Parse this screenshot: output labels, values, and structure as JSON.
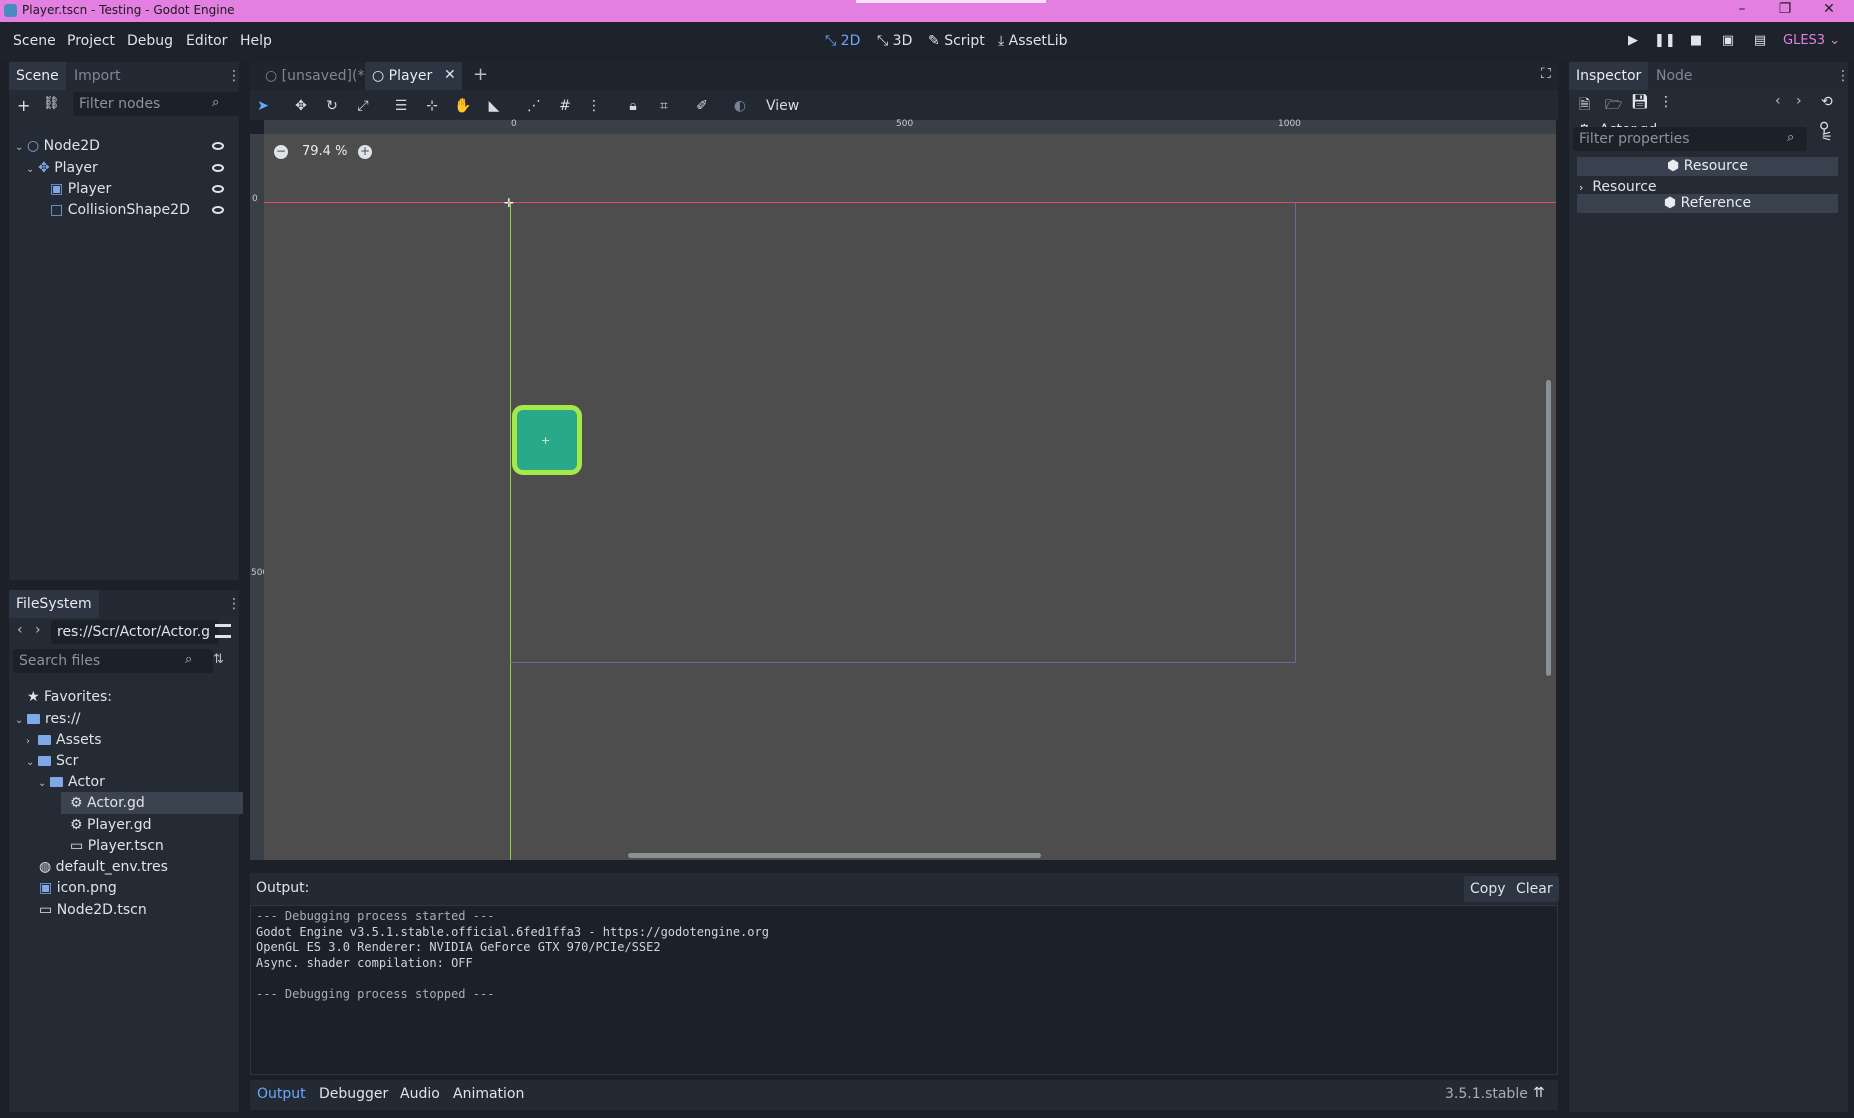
{
  "window": {
    "title": "Player.tscn - Testing - Godot Engine",
    "minimize": "–",
    "maximize": "❐",
    "close": "✕"
  },
  "menu": [
    "Scene",
    "Project",
    "Debug",
    "Editor",
    "Help"
  ],
  "workspaces": [
    {
      "label": "2D",
      "icon": "2d-icon",
      "active": true
    },
    {
      "label": "3D",
      "icon": "3d-icon",
      "active": false
    },
    {
      "label": "Script",
      "icon": "script-icon",
      "active": false
    },
    {
      "label": "AssetLib",
      "icon": "assetlib-icon",
      "active": false
    }
  ],
  "renderer": "GLES3",
  "scene_dock": {
    "tabs": [
      "Scene",
      "Import"
    ],
    "filter_placeholder": "Filter nodes",
    "tree": [
      {
        "label": "Node2D",
        "icon": "node2d-icon"
      },
      {
        "label": "Player",
        "icon": "kinematic-body-icon"
      },
      {
        "label": "Player",
        "icon": "sprite-icon"
      },
      {
        "label": "CollisionShape2D",
        "icon": "collision-shape-icon"
      }
    ]
  },
  "filesystem": {
    "title": "FileSystem",
    "path": "res://Scr/Actor/Actor.g",
    "search_placeholder": "Search files",
    "items": [
      {
        "label": "Favorites:",
        "icon": "star-icon"
      },
      {
        "label": "res://",
        "icon": "folder-icon"
      },
      {
        "label": "Assets",
        "icon": "folder-icon"
      },
      {
        "label": "Scr",
        "icon": "folder-icon"
      },
      {
        "label": "Actor",
        "icon": "folder-icon"
      },
      {
        "label": "Actor.gd",
        "icon": "gear-icon",
        "selected": true
      },
      {
        "label": "Player.gd",
        "icon": "gear-icon"
      },
      {
        "label": "Player.tscn",
        "icon": "scene-icon"
      },
      {
        "label": "default_env.tres",
        "icon": "globe-icon"
      },
      {
        "label": "icon.png",
        "icon": "image-icon"
      },
      {
        "label": "Node2D.tscn",
        "icon": "scene-icon"
      }
    ]
  },
  "editor_tabs": [
    {
      "label": "[unsaved](*)",
      "active": false
    },
    {
      "label": "Player",
      "active": true
    }
  ],
  "viewport": {
    "zoom": "79.4 %",
    "view_menu": "View",
    "ruler_labels": [
      "0",
      "500",
      "1000"
    ],
    "ruler_v_labels": [
      "0",
      "500"
    ],
    "accent_colors": {
      "x_axis": "#e0486c",
      "y_axis": "#8fd23a",
      "sprite": "#2aa88a",
      "sprite_outline": "#a6e84a"
    }
  },
  "inspector": {
    "tabs": [
      "Inspector",
      "Node"
    ],
    "object": "Actor.gd",
    "filter_placeholder": "Filter properties",
    "sections": [
      "Resource",
      "Resource",
      "Reference"
    ]
  },
  "output": {
    "title": "Output:",
    "copy_label": "Copy",
    "clear_label": "Clear",
    "lines": [
      "--- Debugging process started ---",
      "Godot Engine v3.5.1.stable.official.6fed1ffa3 - https://godotengine.org",
      "OpenGL ES 3.0 Renderer: NVIDIA GeForce GTX 970/PCIe/SSE2",
      "Async. shader compilation: OFF",
      "",
      "--- Debugging process stopped ---"
    ]
  },
  "bottom_tabs": [
    "Output",
    "Debugger",
    "Audio",
    "Animation"
  ],
  "version": "3.5.1.stable"
}
